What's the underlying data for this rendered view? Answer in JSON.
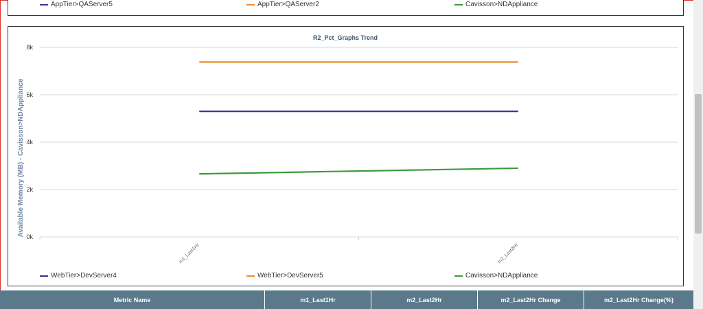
{
  "top_legend": {
    "items": [
      {
        "label": "AppTier>QAServer5",
        "color": "#3a3592"
      },
      {
        "label": "AppTier>QAServer2",
        "color": "#f08c30"
      },
      {
        "label": "Cavisson>NDAppliance",
        "color": "#3b9a3b"
      }
    ]
  },
  "chart": {
    "title": "R2_Pct_Graphs Trend",
    "legend": [
      {
        "label": "WebTier>DevServer4",
        "color": "#3a3592"
      },
      {
        "label": "WebTier>DevServer5",
        "color": "#f08c30"
      },
      {
        "label": "Cavisson>NDAppliance",
        "color": "#3b9a3b"
      }
    ]
  },
  "chart_data": {
    "type": "line",
    "title": "R2_Pct_Graphs Trend",
    "xlabel": "",
    "ylabel": "Available Memory (MB) - Cavisson>NDAppliance",
    "categories": [
      "m1_Last1Hr",
      "m2_Last2Hr"
    ],
    "ylim": [
      0,
      8000
    ],
    "yticks": [
      {
        "value": 0,
        "label": "0k"
      },
      {
        "value": 2000,
        "label": "2k"
      },
      {
        "value": 4000,
        "label": "4k"
      },
      {
        "value": 6000,
        "label": "6k"
      },
      {
        "value": 8000,
        "label": "8k"
      }
    ],
    "grid": true,
    "legend_position": "bottom",
    "series": [
      {
        "name": "WebTier>DevServer4",
        "color": "#3a3592",
        "values": [
          5300,
          5300
        ]
      },
      {
        "name": "WebTier>DevServer5",
        "color": "#f08c30",
        "values": [
          7380,
          7380
        ]
      },
      {
        "name": "Cavisson>NDAppliance",
        "color": "#3b9a3b",
        "values": [
          2660,
          2900
        ]
      }
    ]
  },
  "table": {
    "headers": [
      "Metric Name",
      "m1_Last1Hr",
      "m2_Last2Hr",
      "m2_Last2Hr Change",
      "m2_Last2Hr Change(%)"
    ]
  }
}
